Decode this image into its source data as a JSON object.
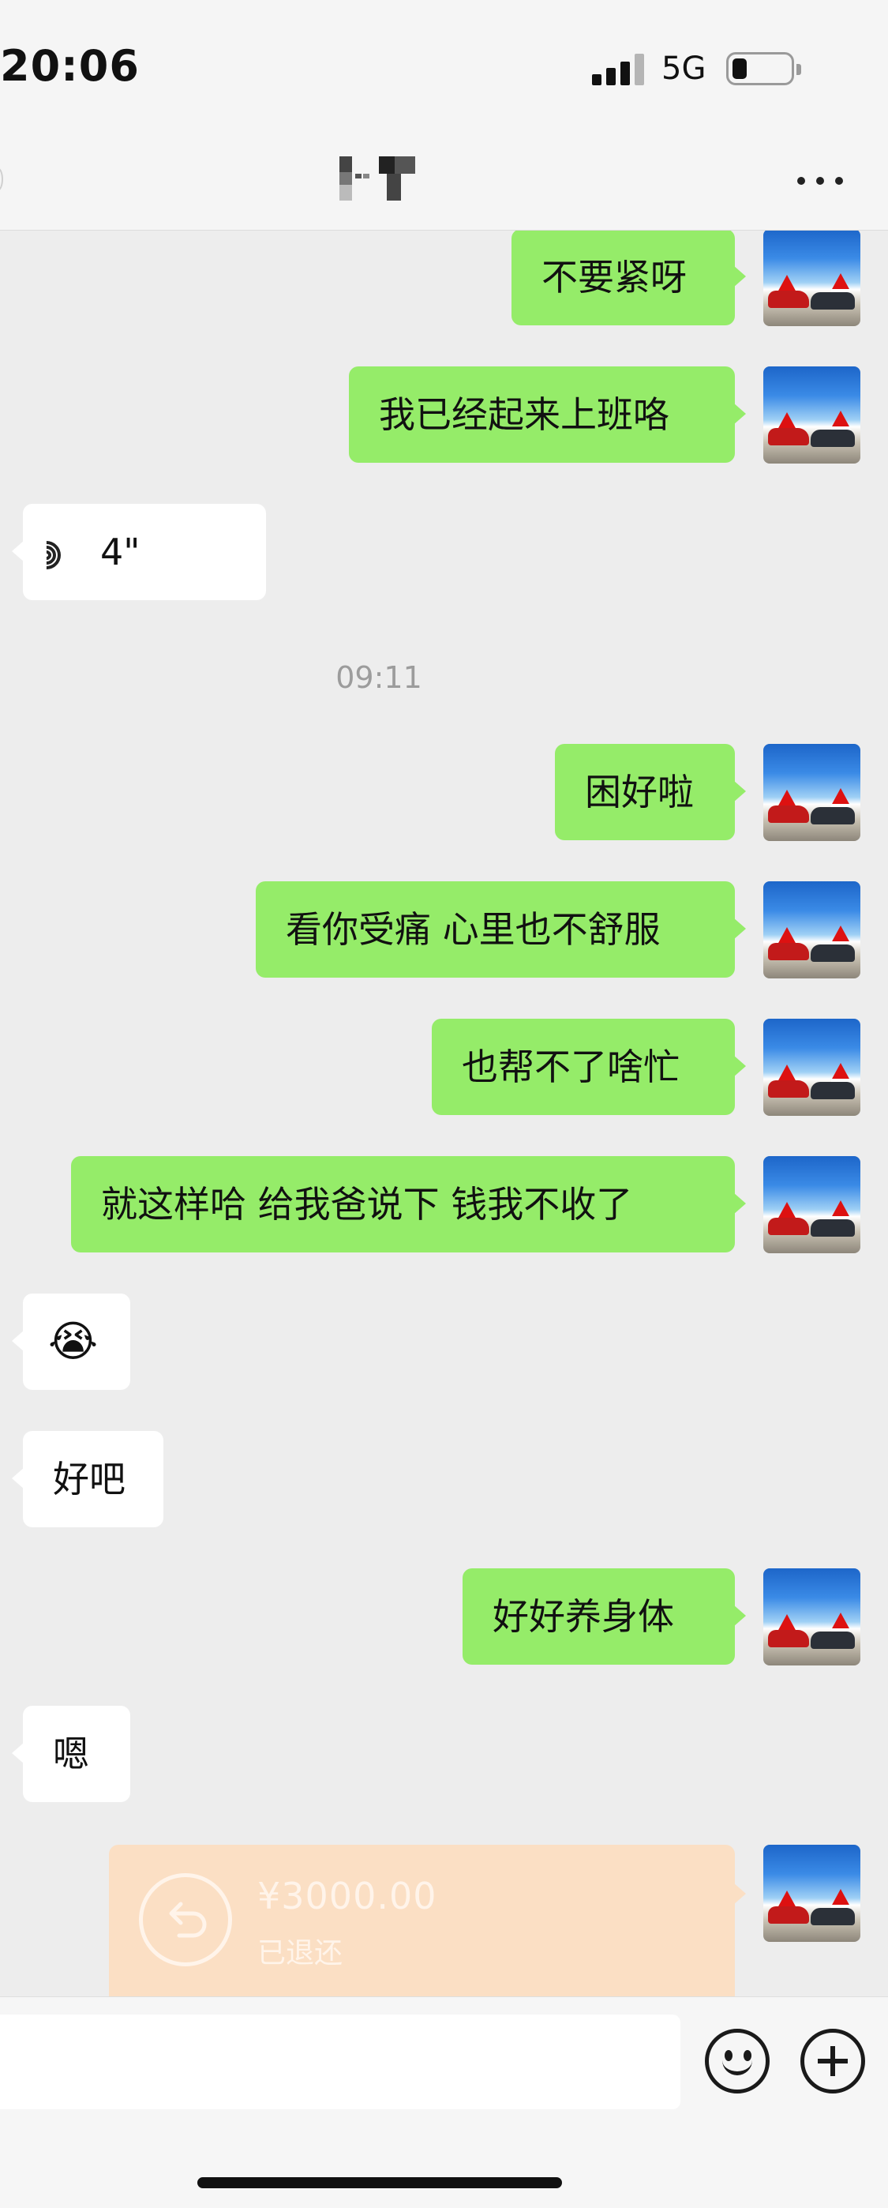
{
  "status_bar": {
    "time": "20:06",
    "network": "5G",
    "signal_bars": 3,
    "battery_level": 0.15
  },
  "nav": {
    "contact_name_pixelated": true
  },
  "messages": {
    "m1": "不要紧呀",
    "m2": "我已经起来上班咯",
    "voice_duration": "4\"",
    "timestamp": "09:11",
    "m3": "困好啦",
    "m4": "看你受痛 心里也不舒服",
    "m5": "也帮不了啥忙",
    "m6": "就这样哈 给我爸说下 钱我不收了",
    "emoji": "😭",
    "m7": "好吧",
    "m8": "好好养身体",
    "m9": "嗯"
  },
  "transfer": {
    "amount": "¥3000.00",
    "status": "已退还"
  },
  "colors": {
    "outgoing_bubble": "#95ec69",
    "incoming_bubble": "#ffffff",
    "transfer_card": "#fbdfc4",
    "background": "#ededed"
  }
}
